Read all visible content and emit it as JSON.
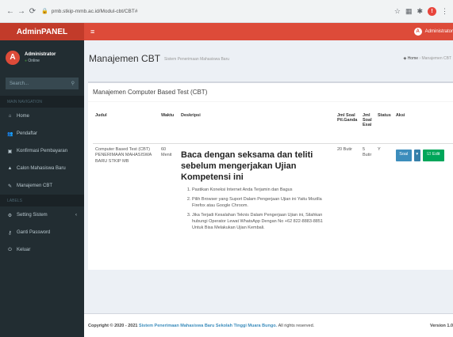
{
  "browser": {
    "url": "pmb.stkip-mmb.ac.id/Modul-cbt/CBT#"
  },
  "header": {
    "logo": "AdminPANEL",
    "user_initial": "A",
    "user_name": "Administrator"
  },
  "sidebar": {
    "user_initial": "A",
    "user_name": "Administrator",
    "user_status": "Online",
    "search_placeholder": "Search...",
    "section_main": "MAIN NAVIGATION",
    "section_label": "LABELS",
    "items": [
      {
        "label": "Home"
      },
      {
        "label": "Pendaftar"
      },
      {
        "label": "Konfirmasi Pembayaran"
      },
      {
        "label": "Calon Mahasiswa Baru"
      },
      {
        "label": "Manajemen CBT"
      }
    ],
    "items2": [
      {
        "label": "Setting Sistem"
      },
      {
        "label": "Ganti Password"
      },
      {
        "label": "Keluar"
      }
    ]
  },
  "content": {
    "title": "Manajemen CBT",
    "subtitle": "Sistem Penerimaan Mahasiswa Baru",
    "breadcrumb_home": "Home",
    "breadcrumb_current": "Manajemen CBT"
  },
  "box": {
    "title": "Manajemen Computer Based Test (CBT)",
    "columns": {
      "judul": "Judul",
      "waktu": "Waktu",
      "deskripsi": "Deskripsi",
      "jml_pg": "Jml Soal Pil.Ganda",
      "jml_esai": "Jml Soal Esai",
      "status": "Status",
      "aksi": "Aksi"
    },
    "row": {
      "judul": "Computer Based Test (CBT) PENERIMAAN MAHASISWA BARU STKIP MB",
      "waktu": "60 Menit",
      "desc_title": "Baca dengan seksama dan teliti sebelum mengerjakan Ujian Kompetensi ini",
      "desc_items": [
        "Pastikan Koneksi Internet Anda Terjamin dan Bagus",
        "Pilih Browser yang Suport Dalam Pengerjaan Ujian ini Yaitu Mozilla Firefox atau Google Chroom.",
        "Jika Terjadi Kesalahan Teknis Dalam Pengerjaan Ujian ini, Silahkan hubungi Operator Lewat WhatsApp Dengan No +62 822-8883-8851 Untuk Bisa Melakukan Ujian Kembali."
      ],
      "jml_pg": "20 Butir",
      "jml_esai": "5 Butir",
      "status": "Y",
      "btn_soal": "Soal",
      "btn_edit": "Edit"
    }
  },
  "footer": {
    "copyright": "Copyright © 2020 - 2021",
    "link": "Sistem Penerimaan Mahasiswa Baru Sekolah Tinggi Muara Bungo.",
    "rights": "All rights reserved.",
    "version": "Version 1.0"
  },
  "icons": {
    "back": "back-arrow-icon",
    "forward": "forward-arrow-icon",
    "reload": "reload-icon",
    "lock": "lock-icon",
    "star": "star-icon",
    "menu": "hamburger-icon"
  },
  "colors": {
    "header_red": "#dd4b39",
    "logo_red": "#c23b2a",
    "sidebar": "#222d32",
    "primary": "#3c8dbc",
    "success": "#00a65a"
  }
}
